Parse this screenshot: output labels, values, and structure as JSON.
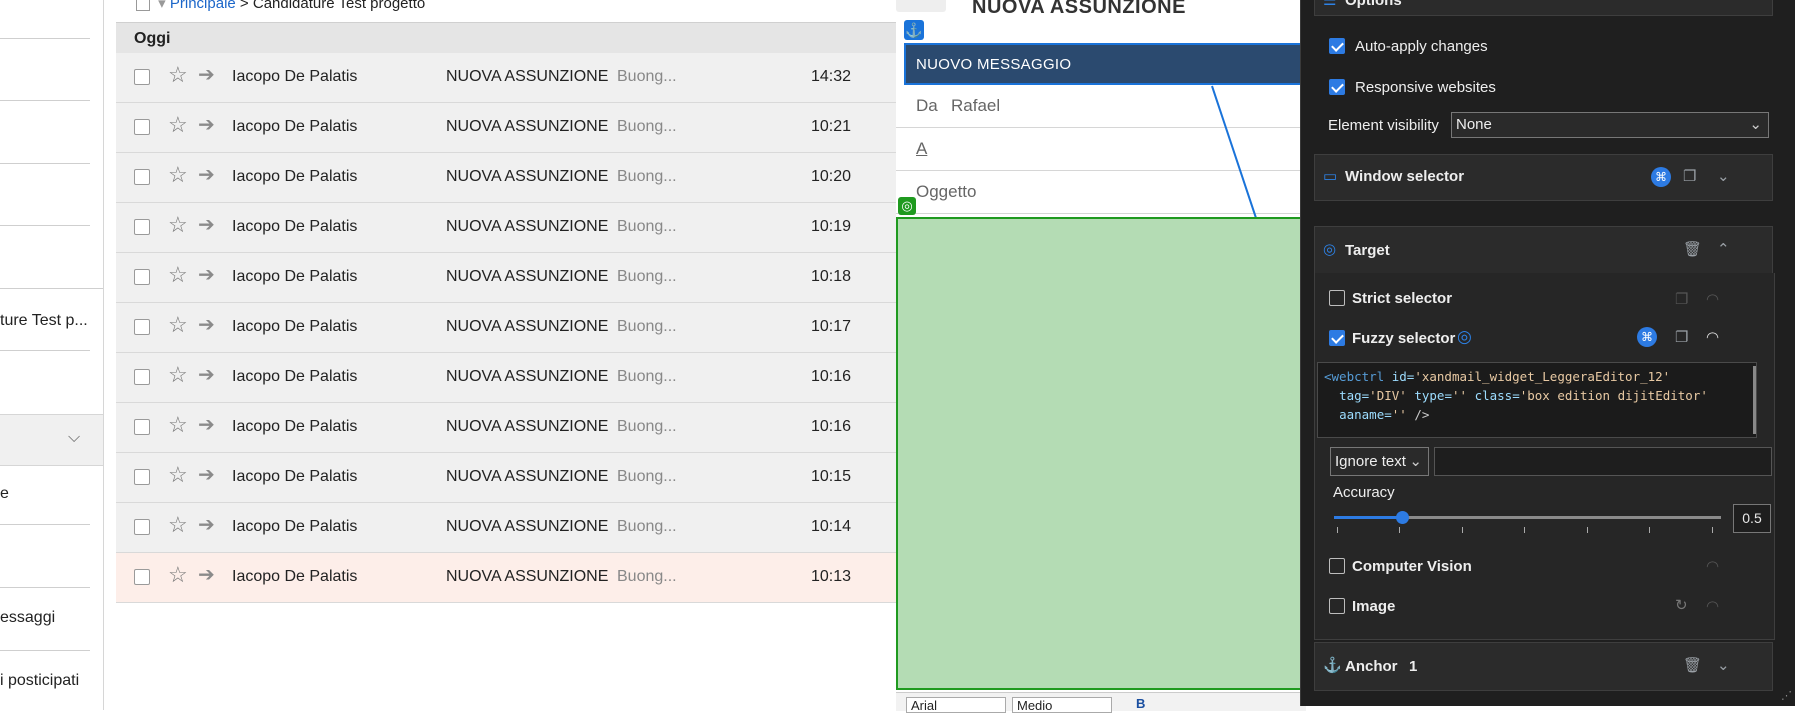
{
  "breadcrumb": {
    "root": "Principale",
    "separator": ">",
    "current": "Candidature Test progetto"
  },
  "sidebar": {
    "items": [
      {
        "label": "ture Test p..."
      },
      {
        "label": "e"
      },
      {
        "label": "essaggi"
      },
      {
        "label": "i posticipati"
      }
    ],
    "collapse_icon": "chevron-down-icon"
  },
  "mail_list": {
    "group_label": "Oggi",
    "rows": [
      {
        "sender": "Iacopo De Palatis",
        "subject": "NUOVA ASSUNZIONE",
        "preview": "Buong...",
        "time": "14:32"
      },
      {
        "sender": "Iacopo De Palatis",
        "subject": "NUOVA ASSUNZIONE",
        "preview": "Buong...",
        "time": "10:21"
      },
      {
        "sender": "Iacopo De Palatis",
        "subject": "NUOVA ASSUNZIONE",
        "preview": "Buong...",
        "time": "10:20"
      },
      {
        "sender": "Iacopo De Palatis",
        "subject": "NUOVA ASSUNZIONE",
        "preview": "Buong...",
        "time": "10:19"
      },
      {
        "sender": "Iacopo De Palatis",
        "subject": "NUOVA ASSUNZIONE",
        "preview": "Buong...",
        "time": "10:18"
      },
      {
        "sender": "Iacopo De Palatis",
        "subject": "NUOVA ASSUNZIONE",
        "preview": "Buong...",
        "time": "10:17"
      },
      {
        "sender": "Iacopo De Palatis",
        "subject": "NUOVA ASSUNZIONE",
        "preview": "Buong...",
        "time": "10:16"
      },
      {
        "sender": "Iacopo De Palatis",
        "subject": "NUOVA ASSUNZIONE",
        "preview": "Buong...",
        "time": "10:16"
      },
      {
        "sender": "Iacopo De Palatis",
        "subject": "NUOVA ASSUNZIONE",
        "preview": "Buong...",
        "time": "10:15"
      },
      {
        "sender": "Iacopo De Palatis",
        "subject": "NUOVA ASSUNZIONE",
        "preview": "Buong...",
        "time": "10:14"
      },
      {
        "sender": "Iacopo De Palatis",
        "subject": "NUOVA ASSUNZIONE",
        "preview": "Buong...",
        "time": "10:13"
      }
    ]
  },
  "compose": {
    "title": "NUOVA ASSUNZIONE",
    "header_label": "NUOVO MESSAGGIO",
    "from_label": "Da",
    "from_value": "Rafael",
    "to_label": "A",
    "subject_label": "Oggetto",
    "toolbar": {
      "font": "Arial",
      "size": "Medio"
    }
  },
  "panel": {
    "options_title": "Options",
    "auto_apply_label": "Auto-apply changes",
    "responsive_label": "Responsive websites",
    "element_visibility_label": "Element visibility",
    "element_visibility_value": "None",
    "window_selector_title": "Window selector",
    "target_title": "Target",
    "strict_selector_label": "Strict selector",
    "fuzzy_selector_label": "Fuzzy selector",
    "selector_code": {
      "line1_tag": "<webctrl",
      "line1_attr": "id=",
      "line1_val": "'xandmail_widget_LeggeraEditor_12'",
      "line2_attr1": "tag=",
      "line2_val1": "'DIV'",
      "line2_attr2": "type=",
      "line2_val2": "''",
      "line2_attr3": "class=",
      "line2_val3": "'box edition dijitEditor'",
      "line3_attr": "aaname=",
      "line3_val": "''",
      "line3_end": "/>"
    },
    "ignore_text_label": "Ignore text",
    "accuracy_label": "Accuracy",
    "accuracy_value": "0.5",
    "computer_vision_label": "Computer Vision",
    "image_label": "Image",
    "anchor_title": "Anchor",
    "anchor_count": "1"
  },
  "colors": {
    "accent": "#2d7be3",
    "editor_highlight": "#b4dcb4",
    "compose_header": "#2b4a6f",
    "panel_bg": "#1f1f1f"
  }
}
